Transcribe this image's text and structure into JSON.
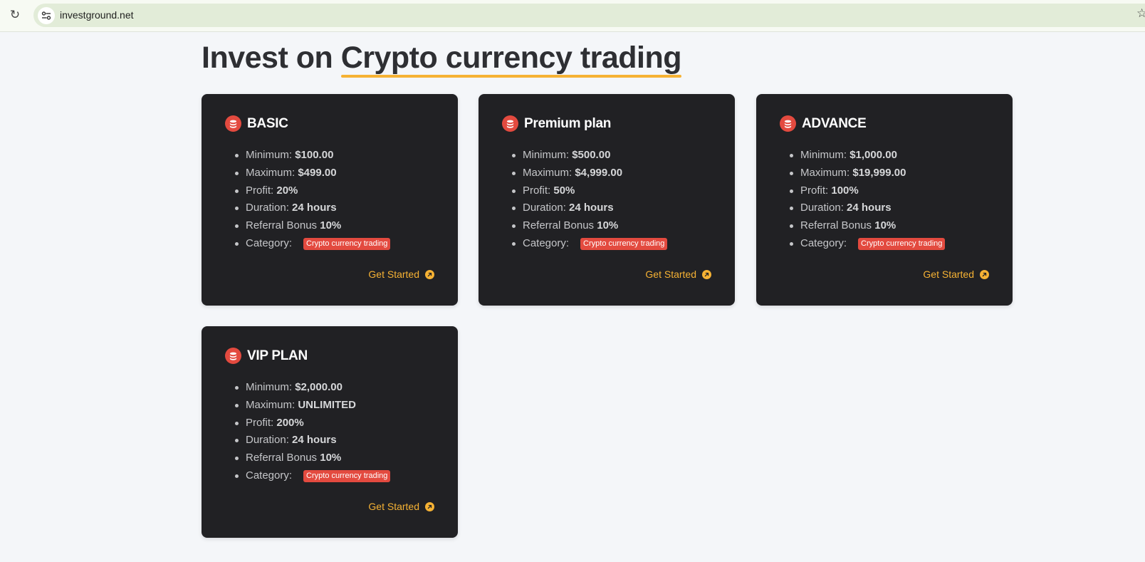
{
  "browser": {
    "url": "investground.net"
  },
  "page": {
    "title_prefix": "Invest on",
    "title_highlight": "Crypto currency trading",
    "accent_color": "#f6b234",
    "badge_color": "#e34a3f",
    "card_color": "#212124"
  },
  "plans": [
    {
      "name": "BASIC",
      "min_label": "Minimum:",
      "min": "$100.00",
      "max_label": "Maximum:",
      "max": "$499.00",
      "profit_label": "Profit:",
      "profit": "20%",
      "duration_label": "Duration:",
      "duration": "24 hours",
      "referral_label": "Referral Bonus",
      "referral": "10%",
      "category_label": "Category:",
      "category": "Crypto currency trading",
      "cta": "Get Started"
    },
    {
      "name": "Premium plan",
      "min_label": "Minimum:",
      "min": "$500.00",
      "max_label": "Maximum:",
      "max": "$4,999.00",
      "profit_label": "Profit:",
      "profit": "50%",
      "duration_label": "Duration:",
      "duration": "24 hours",
      "referral_label": "Referral Bonus",
      "referral": "10%",
      "category_label": "Category:",
      "category": "Crypto currency trading",
      "cta": "Get Started"
    },
    {
      "name": "ADVANCE",
      "min_label": "Minimum:",
      "min": "$1,000.00",
      "max_label": "Maximum:",
      "max": "$19,999.00",
      "profit_label": "Profit:",
      "profit": "100%",
      "duration_label": "Duration:",
      "duration": "24 hours",
      "referral_label": "Referral Bonus",
      "referral": "10%",
      "category_label": "Category:",
      "category": "Crypto currency trading",
      "cta": "Get Started"
    },
    {
      "name": "VIP PLAN",
      "min_label": "Minimum:",
      "min": "$2,000.00",
      "max_label": "Maximum:",
      "max": "UNLIMITED",
      "profit_label": "Profit:",
      "profit": "200%",
      "duration_label": "Duration:",
      "duration": "24 hours",
      "referral_label": "Referral Bonus",
      "referral": "10%",
      "category_label": "Category:",
      "category": "Crypto currency trading",
      "cta": "Get Started"
    }
  ],
  "icons": {
    "reload": "reload-icon",
    "site_info": "tune-icon",
    "bookmark": "star-icon",
    "plan": "database-icon",
    "cta": "arrow-up-right-circle-icon"
  }
}
